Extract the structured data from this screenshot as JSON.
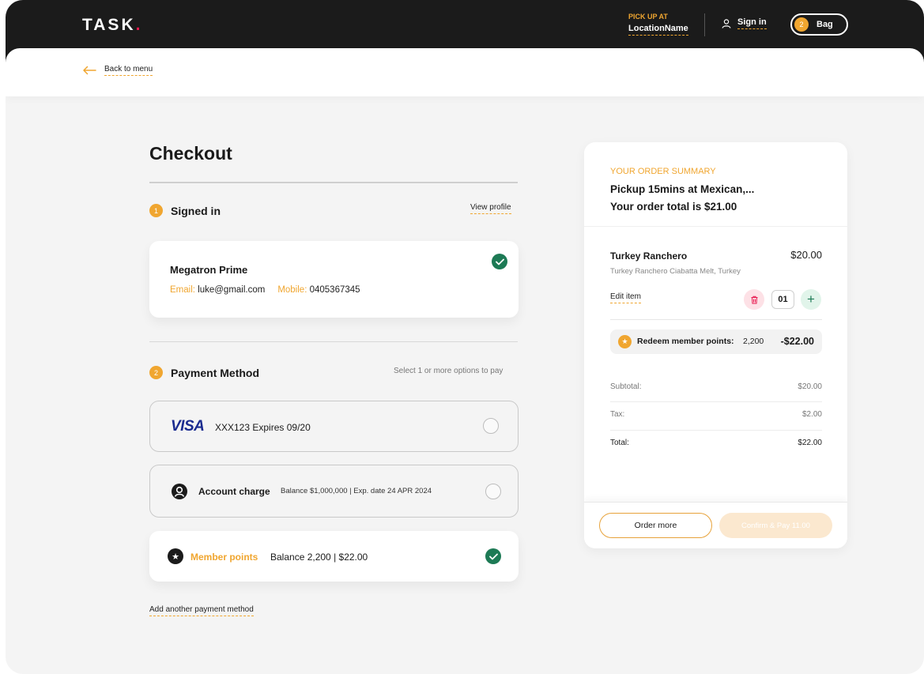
{
  "brand": {
    "logo": "TASK",
    "logo_dot": "."
  },
  "header": {
    "pickup_label": "PICK UP AT",
    "location_name": "LocationName",
    "sign_in": "Sign in",
    "bag_count": "2",
    "bag_label": "Bag"
  },
  "nav": {
    "back_label": "Back to menu"
  },
  "checkout": {
    "title": "Checkout",
    "step1": {
      "number": "1",
      "title": "Signed in",
      "view_profile": "View profile",
      "user_name": "Megatron Prime",
      "email_label": "Email:",
      "email": "luke@gmail.com",
      "mobile_label": "Mobile:",
      "mobile": "0405367345"
    },
    "step2": {
      "number": "2",
      "title": "Payment Method",
      "hint": "Select 1 or more options to pay",
      "options": [
        {
          "brand": "VISA",
          "text": "XXX123  Expires 09/20",
          "selected": false
        },
        {
          "title": "Account charge",
          "detail": "Balance $1,000,000 | Exp. date 24 APR 2024",
          "selected": false
        },
        {
          "title": "Member points",
          "detail": "Balance 2,200 | $22.00",
          "selected": true
        }
      ],
      "add_payment": "Add another payment method"
    }
  },
  "summary": {
    "label": "YOUR ORDER SUMMARY",
    "line1": "Pickup 15mins at Mexican,...",
    "line2": "Your order total is $21.00",
    "item": {
      "name": "Turkey Ranchero",
      "price": "$20.00",
      "description": "Turkey Ranchero Ciabatta Melt, Turkey",
      "edit": "Edit item",
      "quantity": "01"
    },
    "redeem": {
      "label": "Redeem member points:",
      "points": "2,200",
      "amount": "-$22.00"
    },
    "totals": [
      {
        "label": "Subtotal:",
        "value": "$20.00"
      },
      {
        "label": "Tax:",
        "value": "$2.00"
      },
      {
        "label": "Total:",
        "value": "$22.00"
      }
    ],
    "order_more": "Order more",
    "confirm": "Confirm & Pay 11.00"
  },
  "colors": {
    "accent": "#f0a630",
    "dark": "#1b1b1b",
    "success": "#1d7a55",
    "visa_blue": "#1a2b8f",
    "brand_dot": "#e8194f"
  },
  "icons": [
    "arrow-left-icon",
    "user-icon",
    "check-icon",
    "account-icon",
    "star-icon",
    "trash-icon",
    "plus-icon"
  ]
}
